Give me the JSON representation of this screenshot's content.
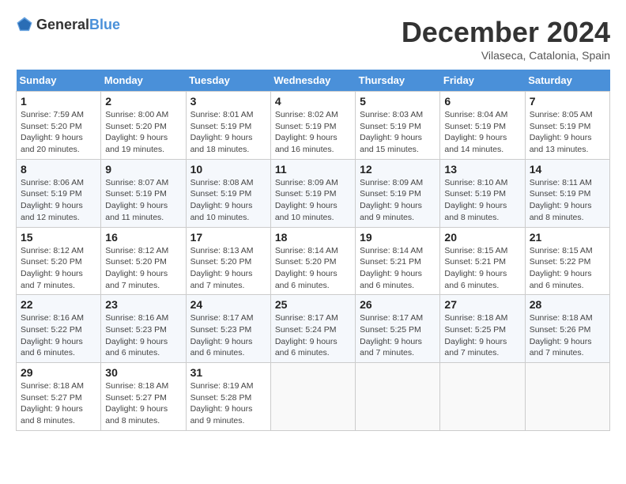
{
  "header": {
    "logo_general": "General",
    "logo_blue": "Blue",
    "month_title": "December 2024",
    "location": "Vilaseca, Catalonia, Spain"
  },
  "weekdays": [
    "Sunday",
    "Monday",
    "Tuesday",
    "Wednesday",
    "Thursday",
    "Friday",
    "Saturday"
  ],
  "weeks": [
    [
      {
        "day": "1",
        "sunrise": "7:59 AM",
        "sunset": "5:20 PM",
        "daylight": "9 hours and 20 minutes."
      },
      {
        "day": "2",
        "sunrise": "8:00 AM",
        "sunset": "5:20 PM",
        "daylight": "9 hours and 19 minutes."
      },
      {
        "day": "3",
        "sunrise": "8:01 AM",
        "sunset": "5:19 PM",
        "daylight": "9 hours and 18 minutes."
      },
      {
        "day": "4",
        "sunrise": "8:02 AM",
        "sunset": "5:19 PM",
        "daylight": "9 hours and 16 minutes."
      },
      {
        "day": "5",
        "sunrise": "8:03 AM",
        "sunset": "5:19 PM",
        "daylight": "9 hours and 15 minutes."
      },
      {
        "day": "6",
        "sunrise": "8:04 AM",
        "sunset": "5:19 PM",
        "daylight": "9 hours and 14 minutes."
      },
      {
        "day": "7",
        "sunrise": "8:05 AM",
        "sunset": "5:19 PM",
        "daylight": "9 hours and 13 minutes."
      }
    ],
    [
      {
        "day": "8",
        "sunrise": "8:06 AM",
        "sunset": "5:19 PM",
        "daylight": "9 hours and 12 minutes."
      },
      {
        "day": "9",
        "sunrise": "8:07 AM",
        "sunset": "5:19 PM",
        "daylight": "9 hours and 11 minutes."
      },
      {
        "day": "10",
        "sunrise": "8:08 AM",
        "sunset": "5:19 PM",
        "daylight": "9 hours and 10 minutes."
      },
      {
        "day": "11",
        "sunrise": "8:09 AM",
        "sunset": "5:19 PM",
        "daylight": "9 hours and 10 minutes."
      },
      {
        "day": "12",
        "sunrise": "8:09 AM",
        "sunset": "5:19 PM",
        "daylight": "9 hours and 9 minutes."
      },
      {
        "day": "13",
        "sunrise": "8:10 AM",
        "sunset": "5:19 PM",
        "daylight": "9 hours and 8 minutes."
      },
      {
        "day": "14",
        "sunrise": "8:11 AM",
        "sunset": "5:19 PM",
        "daylight": "9 hours and 8 minutes."
      }
    ],
    [
      {
        "day": "15",
        "sunrise": "8:12 AM",
        "sunset": "5:20 PM",
        "daylight": "9 hours and 7 minutes."
      },
      {
        "day": "16",
        "sunrise": "8:12 AM",
        "sunset": "5:20 PM",
        "daylight": "9 hours and 7 minutes."
      },
      {
        "day": "17",
        "sunrise": "8:13 AM",
        "sunset": "5:20 PM",
        "daylight": "9 hours and 7 minutes."
      },
      {
        "day": "18",
        "sunrise": "8:14 AM",
        "sunset": "5:20 PM",
        "daylight": "9 hours and 6 minutes."
      },
      {
        "day": "19",
        "sunrise": "8:14 AM",
        "sunset": "5:21 PM",
        "daylight": "9 hours and 6 minutes."
      },
      {
        "day": "20",
        "sunrise": "8:15 AM",
        "sunset": "5:21 PM",
        "daylight": "9 hours and 6 minutes."
      },
      {
        "day": "21",
        "sunrise": "8:15 AM",
        "sunset": "5:22 PM",
        "daylight": "9 hours and 6 minutes."
      }
    ],
    [
      {
        "day": "22",
        "sunrise": "8:16 AM",
        "sunset": "5:22 PM",
        "daylight": "9 hours and 6 minutes."
      },
      {
        "day": "23",
        "sunrise": "8:16 AM",
        "sunset": "5:23 PM",
        "daylight": "9 hours and 6 minutes."
      },
      {
        "day": "24",
        "sunrise": "8:17 AM",
        "sunset": "5:23 PM",
        "daylight": "9 hours and 6 minutes."
      },
      {
        "day": "25",
        "sunrise": "8:17 AM",
        "sunset": "5:24 PM",
        "daylight": "9 hours and 6 minutes."
      },
      {
        "day": "26",
        "sunrise": "8:17 AM",
        "sunset": "5:25 PM",
        "daylight": "9 hours and 7 minutes."
      },
      {
        "day": "27",
        "sunrise": "8:18 AM",
        "sunset": "5:25 PM",
        "daylight": "9 hours and 7 minutes."
      },
      {
        "day": "28",
        "sunrise": "8:18 AM",
        "sunset": "5:26 PM",
        "daylight": "9 hours and 7 minutes."
      }
    ],
    [
      {
        "day": "29",
        "sunrise": "8:18 AM",
        "sunset": "5:27 PM",
        "daylight": "9 hours and 8 minutes."
      },
      {
        "day": "30",
        "sunrise": "8:18 AM",
        "sunset": "5:27 PM",
        "daylight": "9 hours and 8 minutes."
      },
      {
        "day": "31",
        "sunrise": "8:19 AM",
        "sunset": "5:28 PM",
        "daylight": "9 hours and 9 minutes."
      },
      null,
      null,
      null,
      null
    ]
  ],
  "labels": {
    "sunrise": "Sunrise:",
    "sunset": "Sunset:",
    "daylight": "Daylight:"
  }
}
